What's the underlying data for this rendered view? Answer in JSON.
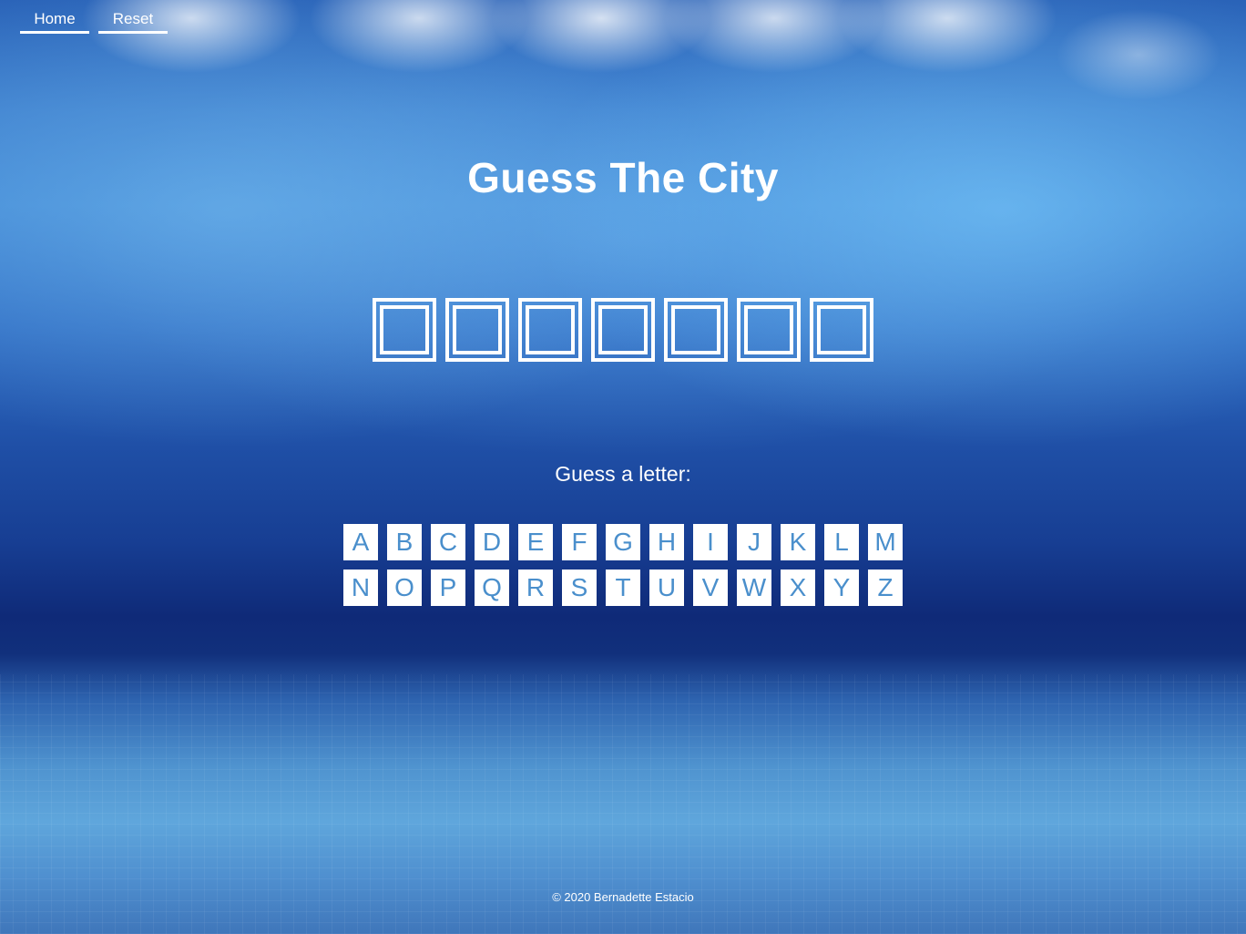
{
  "nav": {
    "home_label": "Home",
    "reset_label": "Reset"
  },
  "game": {
    "title": "Guess The City",
    "word_slots": [
      "",
      "",
      "",
      "",
      "",
      "",
      ""
    ],
    "prompt": "Guess a letter:",
    "letters": [
      "A",
      "B",
      "C",
      "D",
      "E",
      "F",
      "G",
      "H",
      "I",
      "J",
      "K",
      "L",
      "M",
      "N",
      "O",
      "P",
      "Q",
      "R",
      "S",
      "T",
      "U",
      "V",
      "W",
      "X",
      "Y",
      "Z"
    ]
  },
  "footer": {
    "copyright": "© 2020 Bernadette Estacio"
  },
  "colors": {
    "text": "#ffffff",
    "key_text": "#4a8fcc",
    "key_bg": "#ffffff"
  }
}
